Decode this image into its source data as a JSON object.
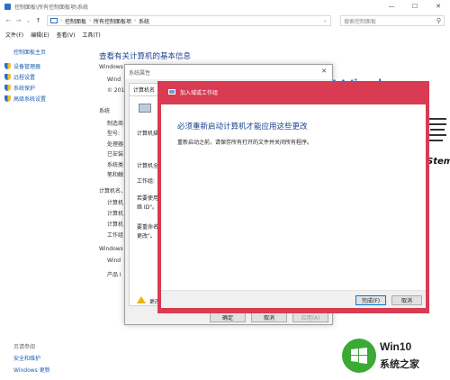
{
  "window": {
    "title": "控制面板\\所有控制面板项\\系统",
    "min": "—",
    "max": "☐",
    "close": "✕"
  },
  "address": {
    "crumbs": [
      "控制面板",
      "所有控制面板项",
      "系统"
    ],
    "search_placeholder": "搜索控制面板"
  },
  "menu": [
    "文件(F)",
    "编辑(E)",
    "查看(V)",
    "工具(T)"
  ],
  "sidebar": {
    "home": "控制面板主页",
    "items": [
      "设备管理器",
      "远程设置",
      "系统保护",
      "高级系统设置"
    ],
    "see_also": "另请参阅",
    "links": [
      "安全和维护",
      "Windows 更新"
    ]
  },
  "main": {
    "title": "查看有关计算机的基本信息",
    "sections": {
      "edition": "Windows",
      "system": "系统",
      "computer": "计算机名、",
      "activation": "Windows"
    },
    "edition_rows": [
      "Wind",
      "© 201"
    ],
    "system_rows": [
      "制造商",
      "型号:",
      "处理器",
      "已安装",
      "系统类",
      "笔和触"
    ],
    "computer_rows": [
      "计算机",
      "计算机",
      "计算机",
      "工作组"
    ],
    "activation_rows": [
      "Wind",
      "产品 I"
    ],
    "brand_text": "Windows 10",
    "vendor_text": "Stem",
    "change_link": "更"
  },
  "sysprops": {
    "title": "系统属性",
    "tab": "计算机名",
    "desc": "计算机描述",
    "fullname": "计算机全名:",
    "workgroup": "工作组:",
    "rename1": "若要使用向",
    "rename2": "络 ID\"。",
    "rename3": "要重命名这",
    "rename4": "更改\"。",
    "warn": "更改",
    "ok": "确定",
    "cancel": "取消",
    "apply": "应用(A)"
  },
  "restart": {
    "title": "加入域或工作组",
    "heading": "必须重新启动计算机才能应用这些更改",
    "message": "重新启动之前，请保存所有打开的文件并关闭所有程序。",
    "finish": "完成(F)",
    "cancel": "取消"
  },
  "watermark": {
    "line1": "Win10",
    "line2": "系统之家"
  }
}
